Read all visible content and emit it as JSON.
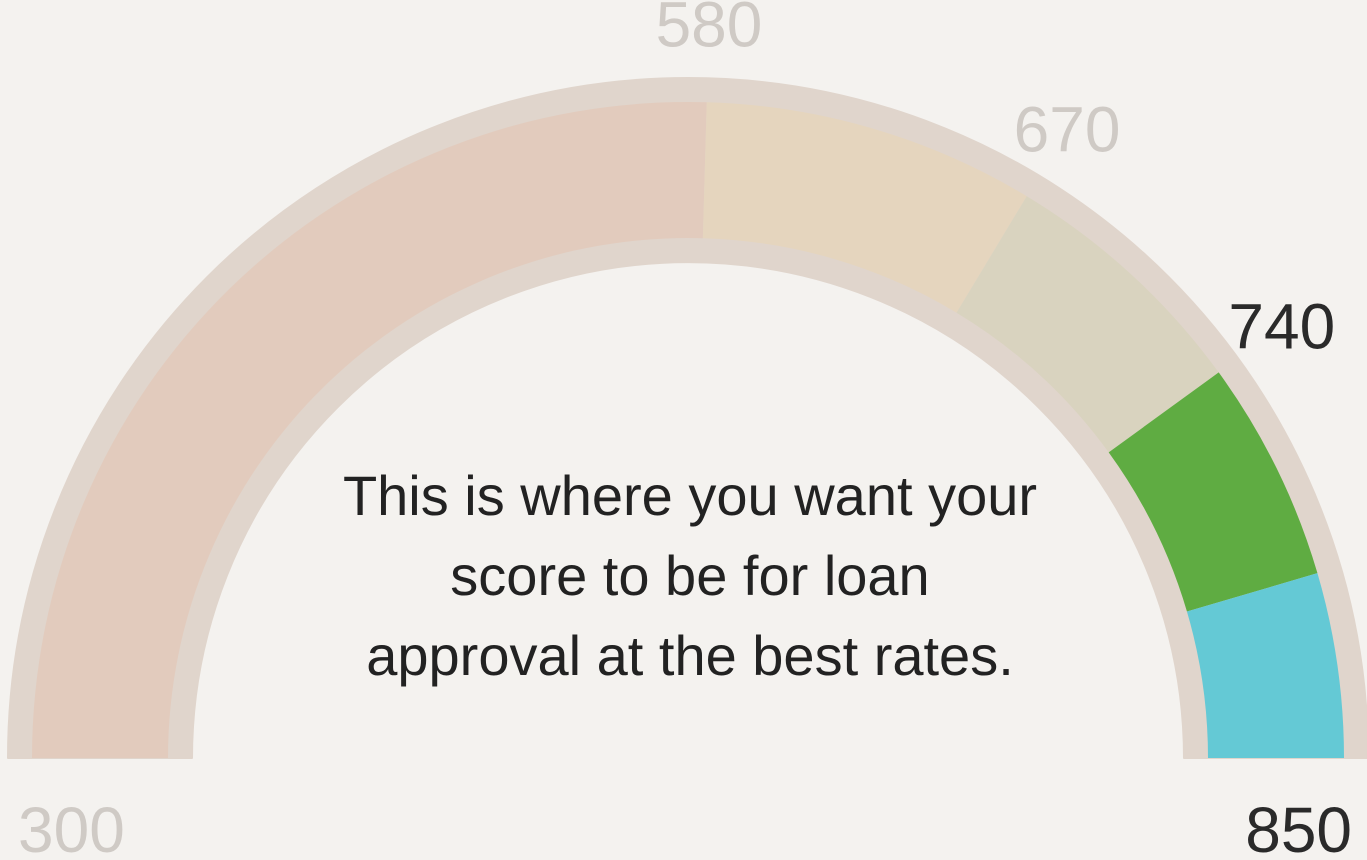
{
  "chart_data": {
    "type": "gauge",
    "scale": {
      "min": 300,
      "max": 850
    },
    "segments": [
      {
        "from": 300,
        "to": 580,
        "color": "#e2cbbd"
      },
      {
        "from": 580,
        "to": 670,
        "color": "#e5d5be"
      },
      {
        "from": 670,
        "to": 740,
        "color": "#d9d3bf"
      },
      {
        "from": 740,
        "to": 800,
        "color": "#5fac42"
      },
      {
        "from": 800,
        "to": 850,
        "color": "#64c9d5"
      }
    ],
    "tick_labels": [
      {
        "value": 300,
        "label": "300",
        "color": "#cfcac5"
      },
      {
        "value": 580,
        "label": "580",
        "color": "#cfcac5"
      },
      {
        "value": 670,
        "label": "670",
        "color": "#cfcac5"
      },
      {
        "value": 740,
        "label": "740",
        "color": "#2a2a2a"
      },
      {
        "value": 850,
        "label": "850",
        "color": "#2a2a2a"
      }
    ],
    "track_color": "#e0d5cc",
    "annotation": "This is where you want your score to be for loan approval at the best rates."
  }
}
